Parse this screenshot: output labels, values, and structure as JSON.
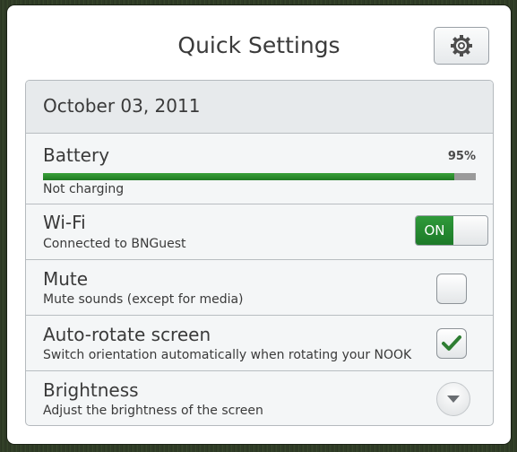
{
  "dialog": {
    "title": "Quick Settings",
    "settings_icon": "gear-icon"
  },
  "date": {
    "label": "October 03, 2011"
  },
  "battery": {
    "label": "Battery",
    "percent_text": "95%",
    "level": 0.95,
    "status": "Not charging",
    "fill_color": "#2a8f2e"
  },
  "wifi": {
    "label": "Wi-Fi",
    "status": "Connected to BNGuest",
    "toggle_label": "ON",
    "on_color": "#25883a"
  },
  "mute": {
    "label": "Mute",
    "description": "Mute sounds (except for media)",
    "checked": false
  },
  "auto_rotate": {
    "label": "Auto-rotate screen",
    "description": "Switch orientation automatically when rotating your NOOK",
    "checked": true,
    "check_color": "#2e7d32"
  },
  "brightness": {
    "label": "Brightness",
    "description": "Adjust the brightness of the screen",
    "expand_icon": "chevron-down-icon"
  }
}
